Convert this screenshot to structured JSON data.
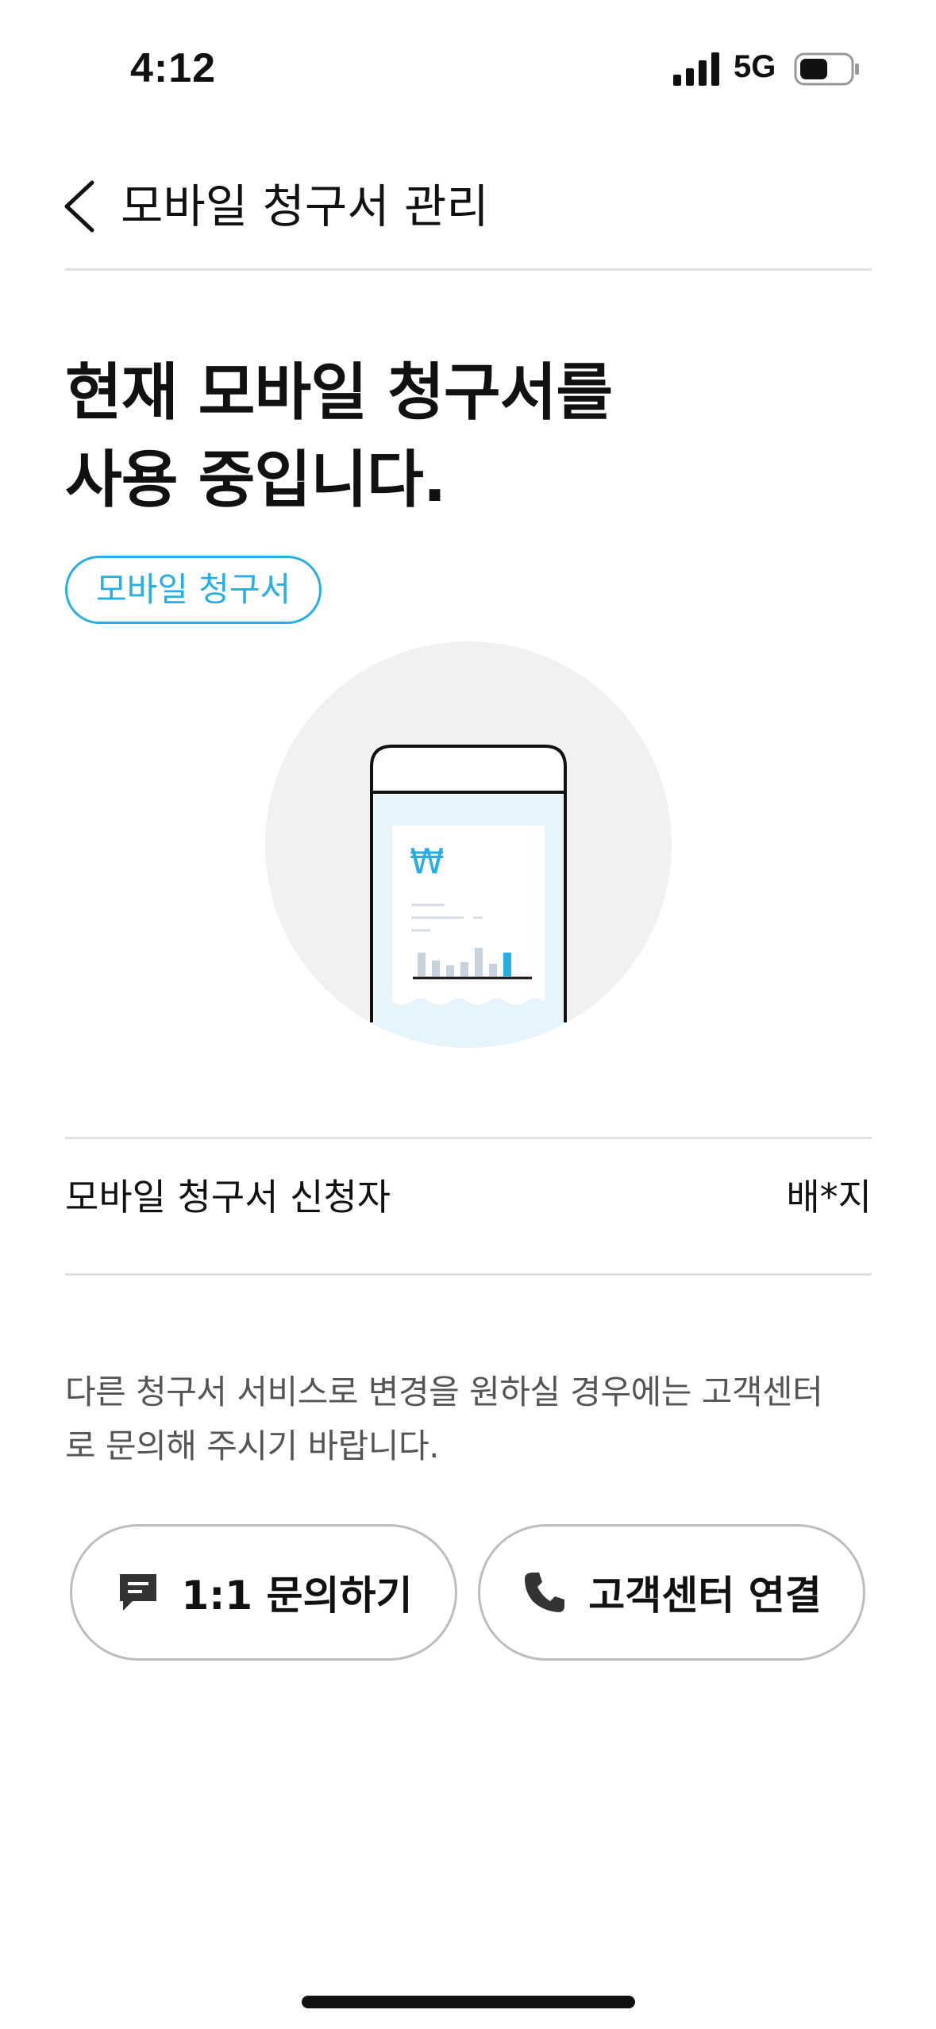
{
  "status_bar": {
    "time": "4:12",
    "network": "5G",
    "icons": [
      "signal-icon",
      "battery-icon"
    ]
  },
  "header": {
    "title": "모바일 청구서 관리",
    "back_icon": "chevron-left-icon"
  },
  "headline": {
    "line1": "현재 모바일 청구서를",
    "line2": "사용 중입니다."
  },
  "chip": {
    "label": "모바일 청구서"
  },
  "illustration": {
    "currency_symbol": "₩",
    "icon": "mobile-bill-illustration",
    "accent_color": "#27aee6"
  },
  "info": {
    "label": "모바일 청구서 신청자",
    "value": "배*지"
  },
  "notice": {
    "line1": "다른 청구서 서비스로 변경을 원하실 경우에는 고객센터",
    "line2": "로 문의해 주시기 바랍니다."
  },
  "buttons": {
    "inquiry": {
      "label": "1:1 문의하기",
      "icon": "chat-icon"
    },
    "callcenter": {
      "label": "고객센터 연결",
      "icon": "phone-icon"
    }
  },
  "colors": {
    "accent": "#27aee6",
    "divider": "#e1e1e1",
    "button_border": "#bdbdbd"
  }
}
